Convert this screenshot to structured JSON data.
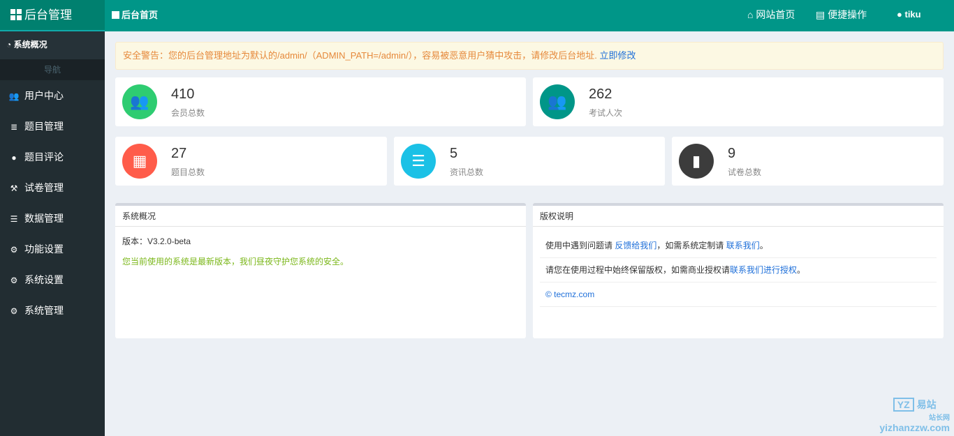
{
  "header": {
    "logo": "后台管理",
    "breadcrumb": "后台首页",
    "nav": [
      {
        "label": "网站首页",
        "icon": "home-icon"
      },
      {
        "label": "便捷操作",
        "icon": "list-alt-icon"
      },
      {
        "label": "tiku",
        "icon": "user-icon"
      }
    ]
  },
  "sidebar": {
    "overview": "系统概况",
    "nav_heading": "导航",
    "items": [
      {
        "label": "用户中心",
        "icon": "users-icon"
      },
      {
        "label": "题目管理",
        "icon": "database-icon"
      },
      {
        "label": "题目评论",
        "icon": "comment-icon"
      },
      {
        "label": "试卷管理",
        "icon": "gavel-icon"
      },
      {
        "label": "数据管理",
        "icon": "list-icon"
      },
      {
        "label": "功能设置",
        "icon": "cogs-icon"
      },
      {
        "label": "系统设置",
        "icon": "cog-icon"
      },
      {
        "label": "系统管理",
        "icon": "cogs-icon"
      }
    ]
  },
  "alert": {
    "text": "安全警告：您的后台管理地址为默认的/admin/（ADMIN_PATH=/admin/），容易被恶意用户猜中攻击，请修改后台地址.",
    "link": "立即修改"
  },
  "stats": [
    {
      "value": "410",
      "label": "会员总数",
      "color": "#2ecc71"
    },
    {
      "value": "262",
      "label": "考试人次",
      "color": "#009688"
    },
    {
      "value": "27",
      "label": "题目总数",
      "color": "#ff5c4a"
    },
    {
      "value": "5",
      "label": "资讯总数",
      "color": "#1bc1e6"
    },
    {
      "value": "9",
      "label": "试卷总数",
      "color": "#3c3c3c"
    }
  ],
  "system": {
    "title": "系统概况",
    "version": "版本：V3.2.0-beta",
    "status": "您当前使用的系统是最新版本，我们昼夜守护您系统的安全。"
  },
  "copyright": {
    "title": "版权说明",
    "l1a": "使用中遇到问题请 ",
    "l1b": "反馈给我们",
    "l1c": "，如需系统定制请 ",
    "l1d": "联系我们",
    "l1e": "。",
    "l2a": "请您在使用过程中始终保留版权，如需商业授权请",
    "l2b": "联系我们进行授权",
    "l2c": "。",
    "site": "© tecmz.com"
  },
  "watermark": {
    "brand": "易站",
    "sub": "站长网",
    "url": "yizhanzzw.com"
  }
}
